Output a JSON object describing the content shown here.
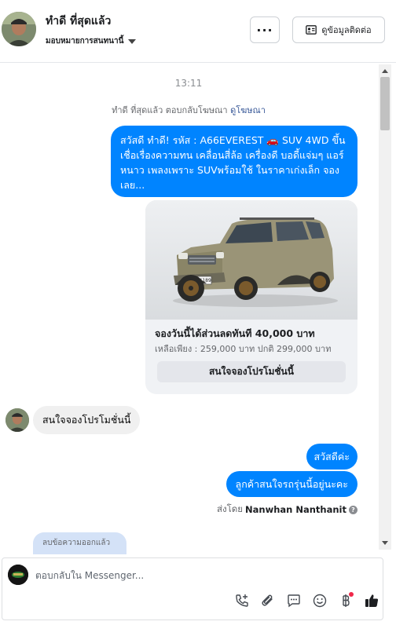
{
  "header": {
    "contact_name": "ทำดี ที่สุดแล้ว",
    "assign_label": "มอบหมายการสนทนานี้",
    "more_label": "···",
    "contact_button_label": "ดูข้อมูลติดต่อ"
  },
  "conversation": {
    "timestamp": "13:11",
    "ad_reply_prefix": "ทำดี ที่สุดแล้ว ตอบกลับโฆษณา",
    "ad_reply_link": "ดูโฆษณา",
    "outgoing_ad_text": "สวัสดี ทำดี!  รหัส : A66EVEREST 🚗 SUV 4WD ขึ้นเชื่อเรื่องความทน เคลื่อนสี่ล้อ เครื่องดี บอดี้แจ่มๆ  แอร์หนาว เพลงเพราะ SUVพร้อมใช้ ในราคาเก่งเล็ก จองเลย...",
    "ad_card": {
      "plate": "ฆษ 4189",
      "title": "จองวันนี้ได้ส่วนลดทันที 40,000 บาท",
      "subtitle": "เหลือเพียง : 259,000 บาท ปกติ 299,000 บาท",
      "cta_label": "สนใจจองโปรโมชั่นนี้"
    },
    "incoming_reply": "สนใจจองโปรโมชั่นนี้",
    "outgoing_messages": [
      "สวัสดีค่ะ",
      "ลูกค้าสนใจรถรุ่นนี้อยู่นะคะ"
    ],
    "sent_by_prefix": "ส่งโดย",
    "sent_by_name": "Nanwhan Nanthanit",
    "info_mark": "?",
    "deleted_notice": "ลบข้อความออกแล้ว"
  },
  "composer": {
    "placeholder": "ตอบกลับใน Messenger...",
    "tools": [
      "call-add-icon",
      "attachment-icon",
      "saved-reply-icon",
      "emoji-icon",
      "payment-icon",
      "like-icon"
    ]
  },
  "colors": {
    "messenger_blue": "#0084ff",
    "incoming_gray": "#f0f0f0",
    "link_blue": "#385898",
    "badge_red": "#f02849"
  }
}
